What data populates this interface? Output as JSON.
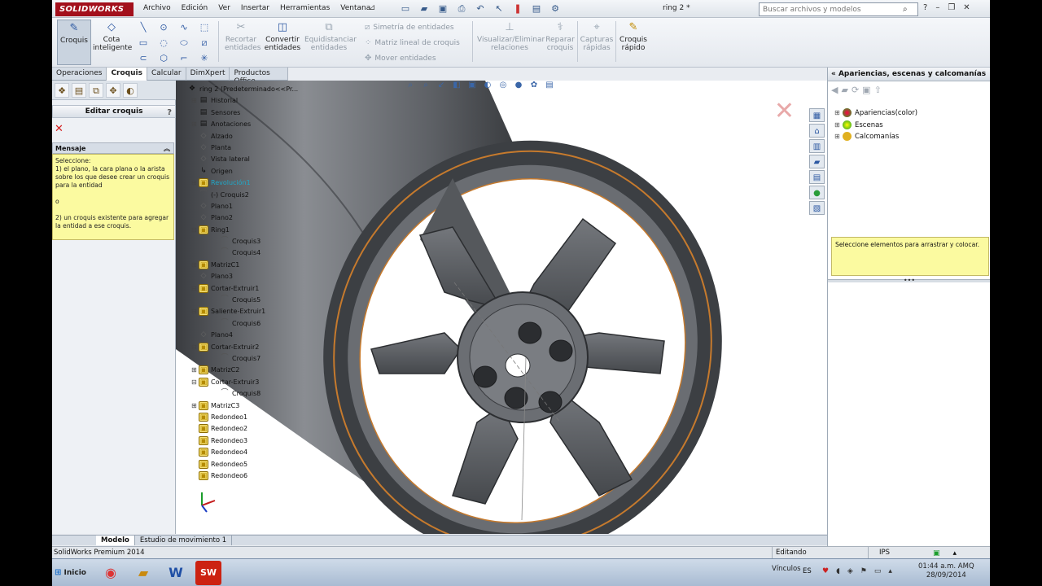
{
  "app": {
    "logo": "SOLIDWORKS",
    "menus": [
      "Archivo",
      "Edición",
      "Ver",
      "Insertar",
      "Herramientas",
      "Ventana"
    ],
    "document_title": "ring 2 *",
    "search_placeholder": "Buscar archivos y modelos",
    "quick_access_icons": [
      "new-icon",
      "open-icon",
      "save-icon",
      "print-icon",
      "undo-icon",
      "select-icon",
      "rebuild-icon",
      "file-properties-icon",
      "options-icon"
    ]
  },
  "commands": {
    "croquis": "Croquis",
    "cota": "Cota\ninteligente",
    "recortar": "Recortar\nentidades",
    "convertir": "Convertir\nentidades",
    "equidistanciar": "Equidistanciar\nentidades",
    "simetria": "Simetría de entidades",
    "matriz_lineal": "Matriz lineal de croquis",
    "mover": "Mover entidades",
    "visualizar": "Visualizar/Eliminar\nrelaciones",
    "reparar": "Reparar\ncroquis",
    "capturas": "Capturas\nrápidas",
    "croquis_rapido": "Croquis\nrápido"
  },
  "tabs": [
    "Operaciones",
    "Croquis",
    "Calcular",
    "DimXpert",
    "Productos Office"
  ],
  "active_tab": "Croquis",
  "property_manager": {
    "title": "Editar croquis",
    "message_header": "Mensaje",
    "message": "Seleccione:\n1) el plano, la cara plana o la arista sobre los que desee crear un croquis para la entidad\n\no\n\n2) un croquis existente para agregar la entidad a ese croquis."
  },
  "tree": [
    {
      "label": "ring 2  (Predeterminado<<Pr...",
      "type": "root",
      "pm": ""
    },
    {
      "label": "Historial",
      "type": "folder",
      "pm": "+"
    },
    {
      "label": "Sensores",
      "type": "folder",
      "pm": ""
    },
    {
      "label": "Anotaciones",
      "type": "folder",
      "pm": "+"
    },
    {
      "label": "Alzado",
      "type": "plane",
      "pm": ""
    },
    {
      "label": "Planta",
      "type": "plane",
      "pm": ""
    },
    {
      "label": "Vista lateral",
      "type": "plane",
      "pm": ""
    },
    {
      "label": "Origen",
      "type": "origin",
      "pm": ""
    },
    {
      "label": "Revolución1",
      "type": "feat",
      "pm": "+",
      "hl": true
    },
    {
      "label": "(-) Croquis2",
      "type": "sketch",
      "pm": ""
    },
    {
      "label": "Plano1",
      "type": "plane",
      "pm": ""
    },
    {
      "label": "Plano2",
      "type": "plane",
      "pm": ""
    },
    {
      "label": "Ring1",
      "type": "feat",
      "pm": "-"
    },
    {
      "label": "Croquis3",
      "type": "sketch",
      "pm": "",
      "indent": true
    },
    {
      "label": "Croquis4",
      "type": "sketch",
      "pm": "",
      "indent": true
    },
    {
      "label": "MatrizC1",
      "type": "feat",
      "pm": "+"
    },
    {
      "label": "Plano3",
      "type": "plane",
      "pm": ""
    },
    {
      "label": "Cortar-Extruir1",
      "type": "feat",
      "pm": "-"
    },
    {
      "label": "Croquis5",
      "type": "sketch",
      "pm": "",
      "indent": true
    },
    {
      "label": "Saliente-Extruir1",
      "type": "feat",
      "pm": "-"
    },
    {
      "label": "Croquis6",
      "type": "sketch",
      "pm": "",
      "indent": true
    },
    {
      "label": "Plano4",
      "type": "plane",
      "pm": ""
    },
    {
      "label": "Cortar-Extruir2",
      "type": "feat",
      "pm": "-"
    },
    {
      "label": "Croquis7",
      "type": "sketch",
      "pm": "",
      "indent": true
    },
    {
      "label": "MatrizC2",
      "type": "feat",
      "pm": "+"
    },
    {
      "label": "Cortar-Extruir3",
      "type": "feat",
      "pm": "-"
    },
    {
      "label": "Croquis8",
      "type": "sketch",
      "pm": "",
      "indent": true
    },
    {
      "label": "MatrizC3",
      "type": "feat",
      "pm": "+"
    },
    {
      "label": "Redondeo1",
      "type": "feat",
      "pm": ""
    },
    {
      "label": "Redondeo2",
      "type": "feat",
      "pm": ""
    },
    {
      "label": "Redondeo3",
      "type": "feat",
      "pm": ""
    },
    {
      "label": "Redondeo4",
      "type": "feat",
      "pm": ""
    },
    {
      "label": "Redondeo5",
      "type": "feat",
      "pm": ""
    },
    {
      "label": "Redondeo6",
      "type": "feat",
      "pm": ""
    }
  ],
  "task_pane": {
    "title": "Apariencias, escenas y calcomanías",
    "items": [
      "Apariencias(color)",
      "Escenas",
      "Calcomanías"
    ],
    "hint": "Seleccione elementos para arrastrar y colocar."
  },
  "bottom_tabs": [
    "Modelo",
    "Estudio de movimiento 1"
  ],
  "status": {
    "product": "SolidWorks Premium 2014",
    "mode": "Editando Pieza",
    "units": "IPS"
  },
  "taskbar": {
    "start": "Inicio",
    "links": "Vínculos",
    "lang": "ES",
    "time": "01:44 a.m. AMQ",
    "date": "28/09/2014"
  }
}
